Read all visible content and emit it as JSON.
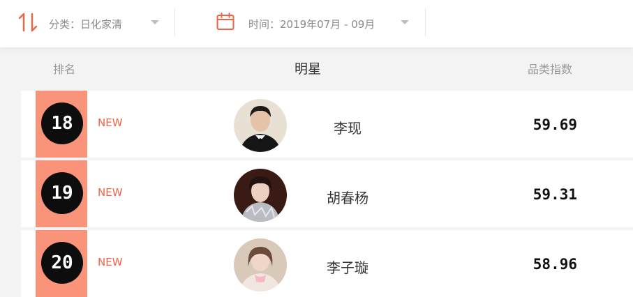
{
  "filters": {
    "category_label": "分类：日化家清",
    "time_label": "时间：2019年07月 - 09月"
  },
  "icons": {
    "sort": "sort-arrows-icon",
    "calendar": "calendar-icon",
    "dropdown": "chevron-down-icon"
  },
  "colors": {
    "accent": "#ef6446",
    "rank_stripe": "#f99379",
    "badge": "#0d0d0d"
  },
  "table": {
    "headers": {
      "rank": "排名",
      "star": "明星",
      "index": "品类指数"
    },
    "rows": [
      {
        "rank": "18",
        "tag": "NEW",
        "name": "李现",
        "score": "59.69"
      },
      {
        "rank": "19",
        "tag": "NEW",
        "name": "胡春杨",
        "score": "59.31"
      },
      {
        "rank": "20",
        "tag": "NEW",
        "name": "李子璇",
        "score": "58.96"
      }
    ]
  }
}
